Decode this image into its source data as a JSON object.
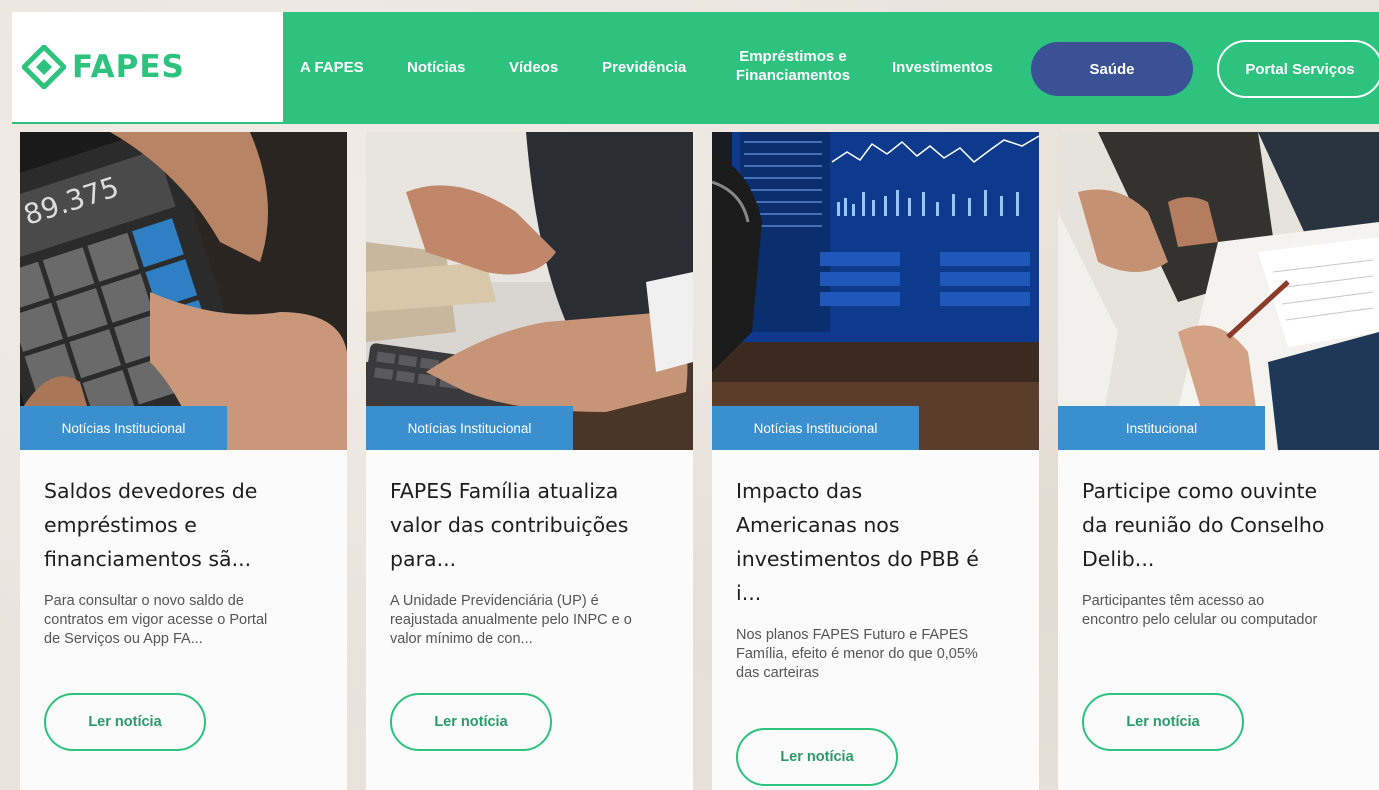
{
  "brand": {
    "name": "FAPES",
    "color": "#2dc37f"
  },
  "nav": {
    "items": [
      {
        "label": "A FAPES"
      },
      {
        "label": "Notícias"
      },
      {
        "label": "Vídeos"
      },
      {
        "label": "Previdência"
      },
      {
        "label_line1": "Empréstimos e",
        "label_line2": "Financiamentos"
      },
      {
        "label": "Investimentos"
      }
    ],
    "saude_label": "Saúde",
    "portal_label": "Portal Serviços"
  },
  "cards": [
    {
      "tag": "Notícias Institucional",
      "title_lines": [
        "Saldos devedores de",
        "empréstimos e",
        "financiamentos sã..."
      ],
      "excerpt_lines": [
        "Para consultar o novo saldo de",
        "contratos em vigor acesse o Portal",
        "de Serviços ou App FA..."
      ],
      "image_text": "89.375",
      "button": "Ler notícia"
    },
    {
      "tag": "Notícias Institucional",
      "title_lines": [
        "FAPES Família atualiza",
        "valor das contribuições",
        "para..."
      ],
      "excerpt_lines": [
        "A Unidade Previdenciária (UP) é",
        "reajustada anualmente pelo INPC e o",
        "valor mínimo de con..."
      ],
      "button": "Ler notícia"
    },
    {
      "tag": "Notícias Institucional",
      "title_lines": [
        "Impacto das",
        "Americanas nos",
        "investimentos do PBB é",
        "i..."
      ],
      "excerpt_lines": [
        "Nos planos FAPES Futuro e FAPES",
        "Família, efeito é menor do que 0,05%",
        "das carteiras"
      ],
      "button": "Ler notícia"
    },
    {
      "tag": "Institucional",
      "title_lines": [
        "Participe como ouvinte",
        "da reunião do Conselho",
        "Delib..."
      ],
      "excerpt_lines": [
        "Participantes têm acesso ao",
        "encontro pelo celular ou computador"
      ],
      "button": "Ler notícia"
    }
  ],
  "colors": {
    "accent": "#2dc37f",
    "tag": "#3a8fcf",
    "saude": "#3a5196"
  }
}
